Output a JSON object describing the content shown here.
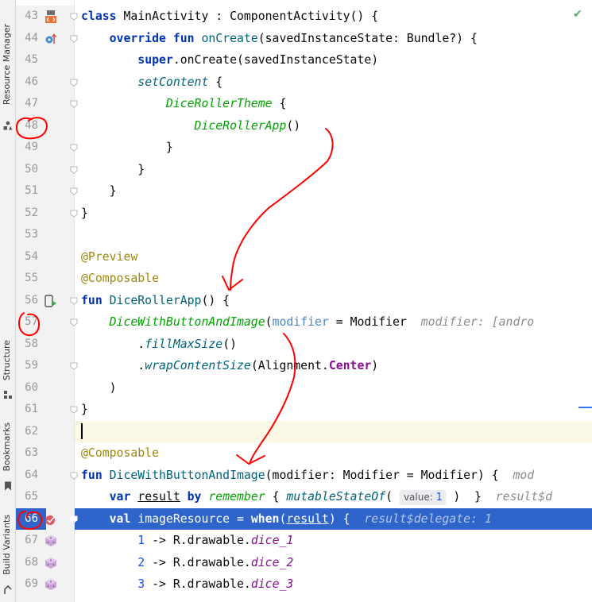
{
  "side_tabs": [
    {
      "label": "Resource Manager",
      "icon": "resource-manager-icon"
    },
    {
      "label": "Structure",
      "icon": "structure-icon"
    },
    {
      "label": "Bookmarks",
      "icon": "bookmark-icon"
    },
    {
      "label": "Build Variants",
      "icon": "build-variants-icon"
    }
  ],
  "status": {
    "icon": "checkmark-icon",
    "color": "#59a869"
  },
  "colors": {
    "execution_line": "#2f65ca",
    "caret_line": "#fcf8e6",
    "annotation_ink": "#ff0000"
  },
  "lines": [
    {
      "num": "43",
      "g": "xml-layout-icon",
      "fold": true,
      "code": [
        [
          "kw",
          "class "
        ],
        [
          "",
          "MainActivity : ComponentActivity() {"
        ]
      ]
    },
    {
      "num": "44",
      "g": "override-icon",
      "fold": true,
      "code": [
        [
          "",
          "    "
        ],
        [
          "kw",
          "override fun "
        ],
        [
          "fn",
          "onCreate"
        ],
        [
          "",
          "(savedInstanceState: Bundle?) {"
        ]
      ]
    },
    {
      "num": "45",
      "code": [
        [
          "",
          "        "
        ],
        [
          "kw",
          "super"
        ],
        [
          "",
          ".onCreate(savedInstanceState)"
        ]
      ]
    },
    {
      "num": "46",
      "fold": true,
      "code": [
        [
          "",
          "        "
        ],
        [
          "ext",
          "setContent"
        ],
        [
          "",
          " {"
        ]
      ]
    },
    {
      "num": "47",
      "fold": true,
      "code": [
        [
          "",
          "            "
        ],
        [
          "cfn",
          "DiceRollerTheme"
        ],
        [
          "",
          " {"
        ]
      ]
    },
    {
      "num": "48",
      "code": [
        [
          "",
          "                "
        ],
        [
          "cfn",
          "DiceRollerApp"
        ],
        [
          "",
          "()"
        ]
      ]
    },
    {
      "num": "49",
      "fold": true,
      "code": [
        [
          "",
          "            }"
        ]
      ]
    },
    {
      "num": "50",
      "fold": true,
      "code": [
        [
          "",
          "        }"
        ]
      ]
    },
    {
      "num": "51",
      "fold": true,
      "code": [
        [
          "",
          "    }"
        ]
      ]
    },
    {
      "num": "52",
      "fold": true,
      "code": [
        [
          "",
          "}"
        ]
      ]
    },
    {
      "num": "53",
      "code": []
    },
    {
      "num": "54",
      "code": [
        [
          "ann",
          "@Preview"
        ]
      ]
    },
    {
      "num": "55",
      "code": [
        [
          "ann",
          "@Composable"
        ]
      ]
    },
    {
      "num": "56",
      "g": "preview-run-icon",
      "fold": true,
      "code": [
        [
          "kw",
          "fun "
        ],
        [
          "fn",
          "DiceRollerApp"
        ],
        [
          "",
          "() {"
        ]
      ]
    },
    {
      "num": "57",
      "fold": true,
      "code": [
        [
          "",
          "    "
        ],
        [
          "cfn",
          "DiceWithButtonAndImage"
        ],
        [
          "",
          "("
        ],
        [
          "prm",
          "modifier"
        ],
        [
          "",
          " = Modifier  "
        ],
        [
          "hint",
          "modifier: [andro"
        ]
      ]
    },
    {
      "num": "58",
      "code": [
        [
          "",
          "        ."
        ],
        [
          "ext",
          "fillMaxSize"
        ],
        [
          "",
          "()"
        ]
      ]
    },
    {
      "num": "59",
      "fold": true,
      "code": [
        [
          "",
          "        ."
        ],
        [
          "ext",
          "wrapContentSize"
        ],
        [
          "",
          "(Alignment."
        ],
        [
          "obj",
          "Center"
        ],
        [
          "",
          ")"
        ]
      ]
    },
    {
      "num": "60",
      "code": [
        [
          "",
          "    )"
        ]
      ]
    },
    {
      "num": "61",
      "fold": true,
      "code": [
        [
          "",
          "}"
        ]
      ]
    },
    {
      "num": "62",
      "code": [],
      "caret": true
    },
    {
      "num": "63",
      "code": [
        [
          "ann",
          "@Composable"
        ]
      ]
    },
    {
      "num": "64",
      "fold": true,
      "code": [
        [
          "kw",
          "fun "
        ],
        [
          "fn",
          "DiceWithButtonAndImage"
        ],
        [
          "",
          "(modifier: Modifier = Modifier) {  "
        ],
        [
          "hint",
          "mod"
        ]
      ]
    },
    {
      "num": "65",
      "code": [
        [
          "",
          "    "
        ],
        [
          "kw",
          "var "
        ],
        [
          "ul",
          "result"
        ],
        [
          "",
          ""
        ],
        [
          "kw",
          " by "
        ],
        [
          "cfn",
          "remember"
        ],
        [
          "",
          " { "
        ],
        [
          "ext",
          "mutableStateOf"
        ],
        [
          "",
          "( "
        ],
        [
          "chip",
          "value: "
        ],
        [
          "chipnum",
          "1"
        ],
        [
          "",
          " )  }  "
        ],
        [
          "hint",
          "result$d"
        ]
      ]
    },
    {
      "num": "66",
      "g": "breakpoint-icon",
      "fold": true,
      "exec": true,
      "code": [
        [
          "",
          "    "
        ],
        [
          "kw",
          "val "
        ],
        [
          "",
          "imageResource = "
        ],
        [
          "kw",
          "when"
        ],
        [
          "",
          "("
        ],
        [
          "ul",
          "result"
        ],
        [
          "",
          ") {  "
        ],
        [
          "hint",
          "result$delegate: 1"
        ]
      ]
    },
    {
      "num": "67",
      "g": "drawable-cube-icon",
      "code": [
        [
          "",
          "        "
        ],
        [
          "num",
          "1"
        ],
        [
          "",
          " -> R.drawable."
        ],
        [
          "fld",
          "dice_1"
        ]
      ]
    },
    {
      "num": "68",
      "g": "drawable-cube-icon",
      "code": [
        [
          "",
          "        "
        ],
        [
          "num",
          "2"
        ],
        [
          "",
          " -> R.drawable."
        ],
        [
          "fld",
          "dice_2"
        ]
      ]
    },
    {
      "num": "69",
      "g": "drawable-cube-icon",
      "code": [
        [
          "",
          "        "
        ],
        [
          "num",
          "3"
        ],
        [
          "",
          " -> R.drawable."
        ],
        [
          "fld",
          "dice_3"
        ]
      ]
    }
  ]
}
